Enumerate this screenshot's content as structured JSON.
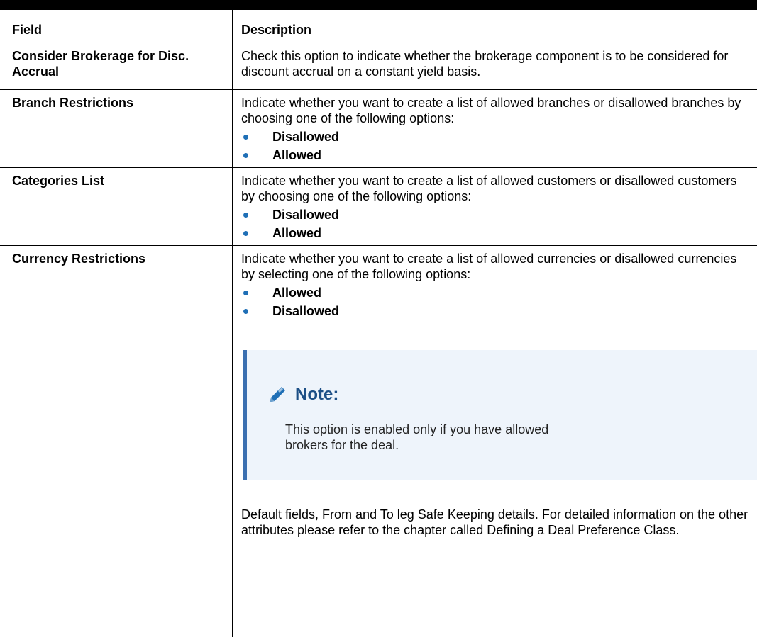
{
  "header": {
    "field": "Field",
    "description": "Description"
  },
  "rows": [
    {
      "field": "Consider Brokerage for Disc. Accrual",
      "description": "Check this option to indicate whether the brokerage component is to be considered for discount accrual on a constant yield basis."
    },
    {
      "field": "Branch Restrictions",
      "description": "Indicate whether you want to create a list of allowed branches or disallowed branches by choosing one of the following options:",
      "options": [
        "Disallowed",
        "Allowed"
      ]
    },
    {
      "field": "Categories List",
      "description": "Indicate whether you want to create a list of allowed customers or disallowed customers by choosing one of the following options:",
      "options": [
        "Disallowed",
        "Allowed"
      ]
    },
    {
      "field": "Currency Restrictions",
      "description": "Indicate whether you want to create a list of allowed currencies or disallowed currencies by selecting one of the following options:",
      "options": [
        "Allowed",
        "Disallowed"
      ],
      "note": {
        "title": "Note:",
        "text": "This option is enabled only if you have allowed brokers for the deal.",
        "icon": "pencil-icon"
      },
      "trailing": "Default fields, From and To leg Safe Keeping details. For detailed information on the other attributes please refer to the chapter called Defining a Deal Preference Class."
    }
  ],
  "colors": {
    "bullet": "#1f6fb6",
    "note_bg": "#eef4fb",
    "note_bar": "#3b6fb0",
    "note_title": "#1c4f86"
  }
}
